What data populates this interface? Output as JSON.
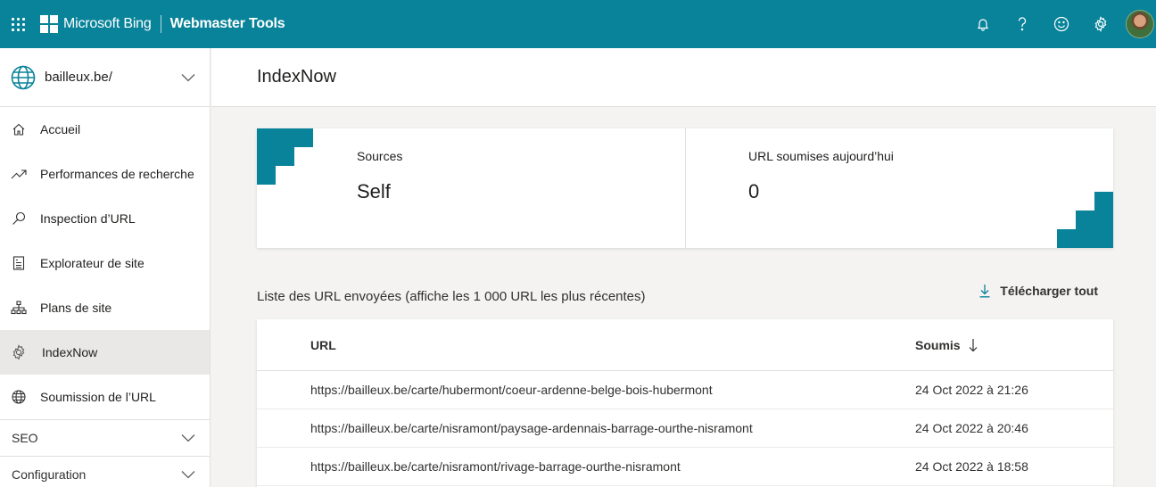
{
  "header": {
    "brand": "Microsoft Bing",
    "product": "Webmaster Tools",
    "icons": [
      "waffle-icon",
      "microsoft-logo-icon",
      "bell-icon",
      "help-icon",
      "feedback-smiley-icon",
      "gear-icon",
      "avatar"
    ]
  },
  "sidebar": {
    "site": "bailleux.be/",
    "items": [
      {
        "label": "Accueil",
        "icon": "home-icon"
      },
      {
        "label": "Performances de recherche",
        "icon": "trend-icon"
      },
      {
        "label": "Inspection d’URL",
        "icon": "search-icon"
      },
      {
        "label": "Explorateur de site",
        "icon": "document-icon"
      },
      {
        "label": "Plans de site",
        "icon": "sitemap-icon"
      },
      {
        "label": "IndexNow",
        "icon": "gear-icon",
        "active": true
      },
      {
        "label": "Soumission de l’URL",
        "icon": "globe-icon"
      }
    ],
    "groups": [
      {
        "label": "SEO"
      },
      {
        "label": "Configuration"
      }
    ]
  },
  "main": {
    "title": "IndexNow",
    "stats": [
      {
        "label": "Sources",
        "value": "Self"
      },
      {
        "label": "URL soumises aujourd’hui",
        "value": "0"
      }
    ],
    "list_title": "Liste des URL envoyées (affiche les 1 000 URL les plus récentes)",
    "download_label": "Télécharger tout",
    "table": {
      "columns": [
        "URL",
        "Soumis"
      ],
      "rows": [
        {
          "url": "https://bailleux.be/carte/hubermont/coeur-ardenne-belge-bois-hubermont",
          "date": "24 Oct 2022 à 21:26"
        },
        {
          "url": "https://bailleux.be/carte/nisramont/paysage-ardennais-barrage-ourthe-nisramont",
          "date": "24 Oct 2022 à 20:46"
        },
        {
          "url": "https://bailleux.be/carte/nisramont/rivage-barrage-ourthe-nisramont",
          "date": "24 Oct 2022 à 18:58"
        }
      ]
    }
  },
  "colors": {
    "accent": "#09839a",
    "active_bg": "#e9e8e7",
    "page_bg": "#f4f3f2"
  }
}
